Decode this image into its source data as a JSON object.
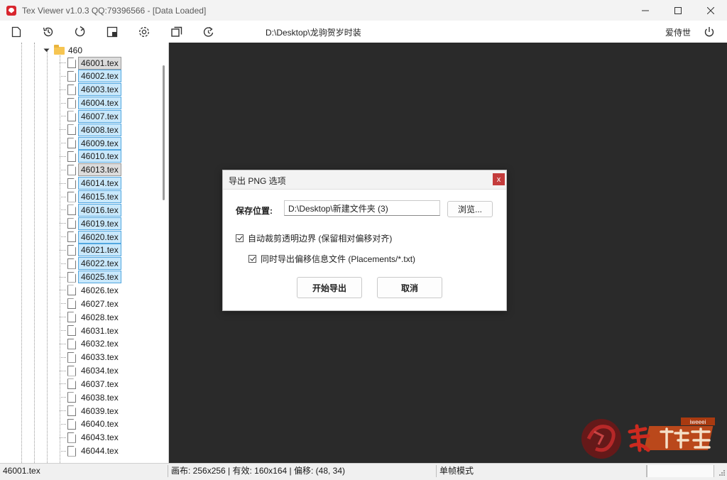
{
  "window": {
    "title": "Tex Viewer v1.0.3 QQ:79396566 - [Data Loaded]"
  },
  "toolbar": {
    "icons": [
      "new-file-icon",
      "history-icon",
      "refresh-icon",
      "crop-icon",
      "settings-icon",
      "copy-icon",
      "reload-clock-icon"
    ],
    "path": "D:\\Desktop\\龙驹贺岁时装",
    "user": "爱侍世"
  },
  "tree": {
    "folder": "460",
    "files": [
      {
        "name": "46001.tex",
        "state": "focus"
      },
      {
        "name": "46002.tex",
        "state": "sel"
      },
      {
        "name": "46003.tex",
        "state": "sel"
      },
      {
        "name": "46004.tex",
        "state": "sel"
      },
      {
        "name": "46007.tex",
        "state": "sel"
      },
      {
        "name": "46008.tex",
        "state": "sel"
      },
      {
        "name": "46009.tex",
        "state": "sel"
      },
      {
        "name": "46010.tex",
        "state": "sel"
      },
      {
        "name": "46013.tex",
        "state": "focus"
      },
      {
        "name": "46014.tex",
        "state": "sel"
      },
      {
        "name": "46015.tex",
        "state": "sel"
      },
      {
        "name": "46016.tex",
        "state": "sel"
      },
      {
        "name": "46019.tex",
        "state": "sel"
      },
      {
        "name": "46020.tex",
        "state": "sel"
      },
      {
        "name": "46021.tex",
        "state": "sel"
      },
      {
        "name": "46022.tex",
        "state": "sel"
      },
      {
        "name": "46025.tex",
        "state": "sel"
      },
      {
        "name": "46026.tex",
        "state": "none"
      },
      {
        "name": "46027.tex",
        "state": "none"
      },
      {
        "name": "46028.tex",
        "state": "none"
      },
      {
        "name": "46031.tex",
        "state": "none"
      },
      {
        "name": "46032.tex",
        "state": "none"
      },
      {
        "name": "46033.tex",
        "state": "none"
      },
      {
        "name": "46034.tex",
        "state": "none"
      },
      {
        "name": "46037.tex",
        "state": "none"
      },
      {
        "name": "46038.tex",
        "state": "none"
      },
      {
        "name": "46039.tex",
        "state": "none"
      },
      {
        "name": "46040.tex",
        "state": "none"
      },
      {
        "name": "46043.tex",
        "state": "none"
      },
      {
        "name": "46044.tex",
        "state": "none"
      }
    ]
  },
  "dialog": {
    "title": "导出 PNG 选项",
    "close_label": "x",
    "save_label": "保存位置:",
    "save_path": "D:\\Desktop\\新建文件夹 (3)",
    "browse_label": "浏览...",
    "option1_label": "自动裁剪透明边界 (保留相对偏移对齐)",
    "option1_checked": true,
    "option2_label": "同时导出偏移信息文件 (Placements/*.txt)",
    "option2_checked": true,
    "start_label": "开始导出",
    "cancel_label": "取消"
  },
  "status": {
    "file": "46001.tex",
    "info": "画布: 256x256 | 有效: 160x164 | 偏移: (48, 34)",
    "mode": "单帧模式",
    "extra": ""
  },
  "colors": {
    "preview_bg": "#2a2a2a",
    "selection_bg": "#c9e8fb",
    "selection_border": "#52a7e0",
    "close_button": "#c43c3c",
    "logo_red": "#d8262e"
  }
}
